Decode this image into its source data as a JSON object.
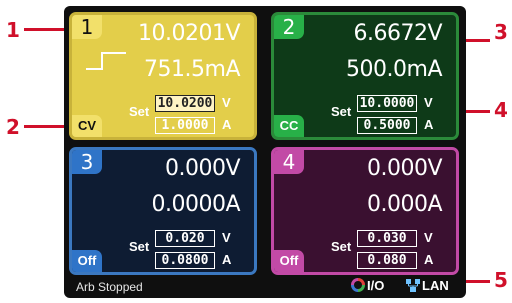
{
  "callouts": [
    "1",
    "2",
    "3",
    "4",
    "5"
  ],
  "channels": [
    {
      "number": "1",
      "voltage": "10.0201V",
      "current": "751.5mA",
      "set_label": "Set",
      "set_voltage": "10.0200",
      "set_current": "1.0000",
      "unit_v": "V",
      "unit_a": "A",
      "mode": "CV",
      "color": "#e3ce4a"
    },
    {
      "number": "2",
      "voltage": "6.6672V",
      "current": "500.0mA",
      "set_label": "Set",
      "set_voltage": "10.0000",
      "set_current": "0.5000",
      "unit_v": "V",
      "unit_a": "A",
      "mode": "CC",
      "color": "#28b048"
    },
    {
      "number": "3",
      "voltage": "0.000V",
      "current": "0.0000A",
      "set_label": "Set",
      "set_voltage": "0.020",
      "set_current": "0.0800",
      "unit_v": "V",
      "unit_a": "A",
      "mode": "Off",
      "color": "#2f74c8"
    },
    {
      "number": "4",
      "voltage": "0.000V",
      "current": "0.000A",
      "set_label": "Set",
      "set_voltage": "0.030",
      "set_current": "0.080",
      "unit_v": "V",
      "unit_a": "A",
      "mode": "Off",
      "color": "#c24aa6"
    }
  ],
  "status": {
    "text": "Arb Stopped",
    "io_label": "I/O",
    "lan_label": "LAN"
  },
  "icons": {
    "io": "io-status-icon",
    "lan": "lan-status-icon",
    "arb": "arb-step-icon"
  }
}
